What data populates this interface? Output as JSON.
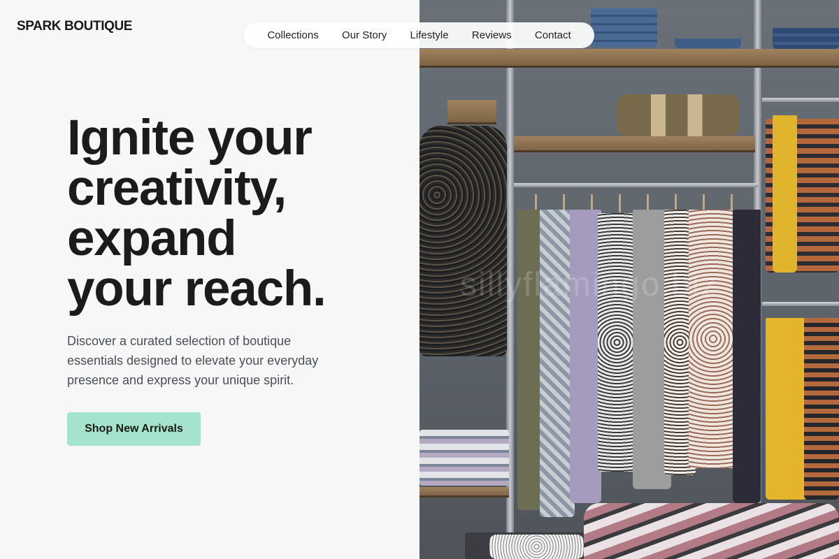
{
  "brand": {
    "name": "SPARK BOUTIQUE"
  },
  "nav": {
    "items": [
      "Collections",
      "Our Story",
      "Lifestyle",
      "Reviews",
      "Contact"
    ]
  },
  "hero": {
    "headline_lines": [
      "Ignite your",
      "creativity,",
      "expand",
      "your reach."
    ],
    "subtext": "Discover a curated selection of boutique essentials designed to elevate your everyday presence and express your unique spirit.",
    "cta_label": "Shop New Arrivals"
  },
  "photo": {
    "watermark": "sillyflamingo.biz",
    "alt": "Boutique clothing rack with dresses and folded garments"
  },
  "colors": {
    "accent": "#a6e3cd",
    "background": "#f7f7f7",
    "text": "#1c1c1c"
  }
}
